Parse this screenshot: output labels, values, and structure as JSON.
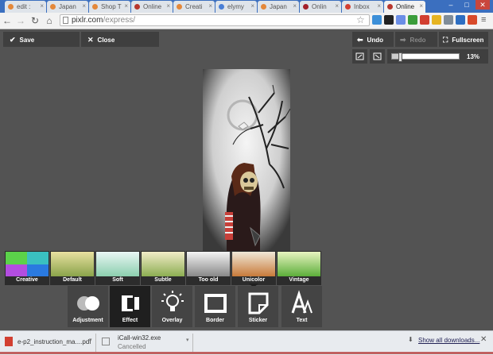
{
  "browser": {
    "tabs": [
      {
        "title": "edit :",
        "color": "#e4883a"
      },
      {
        "title": "Japan",
        "color": "#e4883a"
      },
      {
        "title": "Shop T",
        "color": "#e4883a"
      },
      {
        "title": "Online",
        "color": "#b8372e"
      },
      {
        "title": "Creati",
        "color": "#e4883a"
      },
      {
        "title": "elymy",
        "color": "#4a7fd6"
      },
      {
        "title": "Japan",
        "color": "#e4883a"
      },
      {
        "title": "Onlin",
        "color": "#a4202a"
      },
      {
        "title": "Inbox",
        "color": "#d23f31"
      },
      {
        "title": "Online",
        "color": "#b8372e"
      }
    ],
    "url_host": "pixlr.com",
    "url_path": "/express/",
    "window_controls": [
      "–",
      "□",
      "✕"
    ],
    "extension_colors": [
      "#3c8fd8",
      "#222222",
      "#6b8ee6",
      "#3b9d3b",
      "#d23f31",
      "#e6b422",
      "#7f8c99",
      "#2d6ec2",
      "#d84a2b"
    ]
  },
  "editor": {
    "save_label": "Save",
    "close_label": "Close",
    "undo_label": "Undo",
    "redo_label": "Redo",
    "fullscreen_label": "Fullscreen",
    "zoom_value": "13%",
    "zoom_fraction": 0.13
  },
  "effects": [
    {
      "label": "Creative"
    },
    {
      "label": "Default"
    },
    {
      "label": "Soft"
    },
    {
      "label": "Subtle"
    },
    {
      "label": "Too old"
    },
    {
      "label": "Unicolor"
    },
    {
      "label": "Vintage"
    }
  ],
  "tools": [
    {
      "label": "Adjustment",
      "icon": "adjustment-icon"
    },
    {
      "label": "Effect",
      "icon": "effect-film-icon"
    },
    {
      "label": "Overlay",
      "icon": "overlay-bulb-icon"
    },
    {
      "label": "Border",
      "icon": "border-frame-icon"
    },
    {
      "label": "Sticker",
      "icon": "sticker-icon"
    },
    {
      "label": "Text",
      "icon": "text-icon"
    }
  ],
  "downloads": {
    "items": [
      {
        "name": "e-p2_instruction_ma....pdf",
        "status": ""
      },
      {
        "name": "iCall-win32.exe",
        "status": "Cancelled"
      }
    ],
    "show_all_label": "Show all downloads..."
  }
}
